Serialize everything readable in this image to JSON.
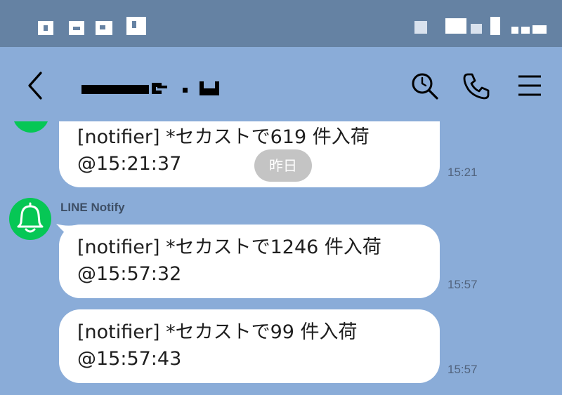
{
  "header": {
    "title": ""
  },
  "chat": {
    "date_separator": "昨日",
    "messages": [
      {
        "line1": "[notifier] *セカストで619 件入荷",
        "line2": "@15:21:37",
        "time": "15:21"
      },
      {
        "line1": "[notifier] *セカストで1246 件入荷",
        "line2": "@15:57:32",
        "time": "15:57"
      },
      {
        "line1": "[notifier] *セカストで99 件入荷",
        "line2": "@15:57:43",
        "time": "15:57"
      }
    ],
    "sender_name": "LINE Notify"
  },
  "icons": {
    "back": "chevron-left-icon",
    "search": "search-icon",
    "call": "phone-icon",
    "menu": "hamburger-menu-icon",
    "avatar": "bell-icon"
  },
  "colors": {
    "background": "#8aacd8",
    "status_bar": "#6582a3",
    "avatar": "#06c755",
    "bubble": "#ffffff"
  }
}
